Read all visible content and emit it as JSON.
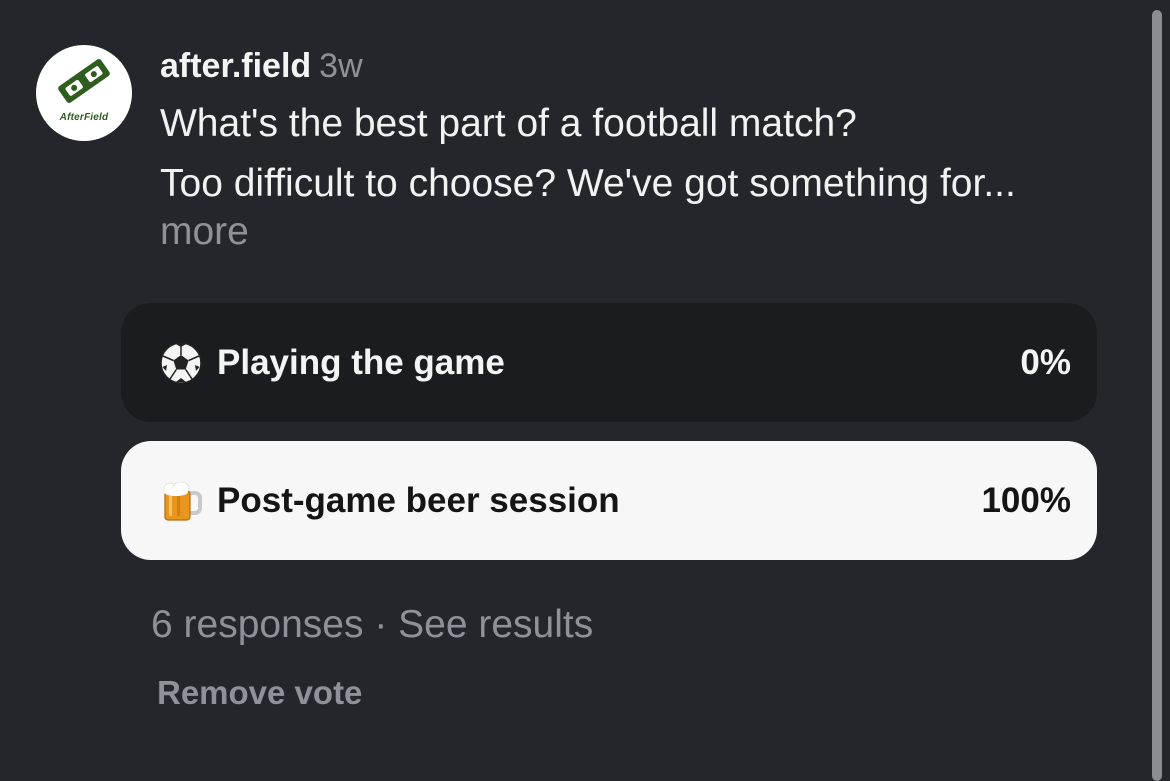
{
  "post": {
    "username": "after.field",
    "time": "3w",
    "avatar_text": "AfterField",
    "avatar_icon": "afterfield-logo",
    "question": "What's the best part of a football match?",
    "body": "Too difficult to choose? We've got something for...",
    "more_label": "more"
  },
  "poll": {
    "options": [
      {
        "emoji": "soccer-ball-icon",
        "label": "Playing the game",
        "percent": "0%",
        "selected": false
      },
      {
        "emoji": "beer-mug-icon",
        "label": "Post-game beer session",
        "percent": "100%",
        "selected": true
      }
    ],
    "responses": "6 responses",
    "separator": "·",
    "see_results": "See results",
    "remove_vote": "Remove vote"
  },
  "colors": {
    "background": "#24262b",
    "option_unselected": "#1b1c20",
    "option_selected": "#f7f7f7",
    "muted_text": "#8e9197",
    "brand_green": "#2f5d1e"
  }
}
